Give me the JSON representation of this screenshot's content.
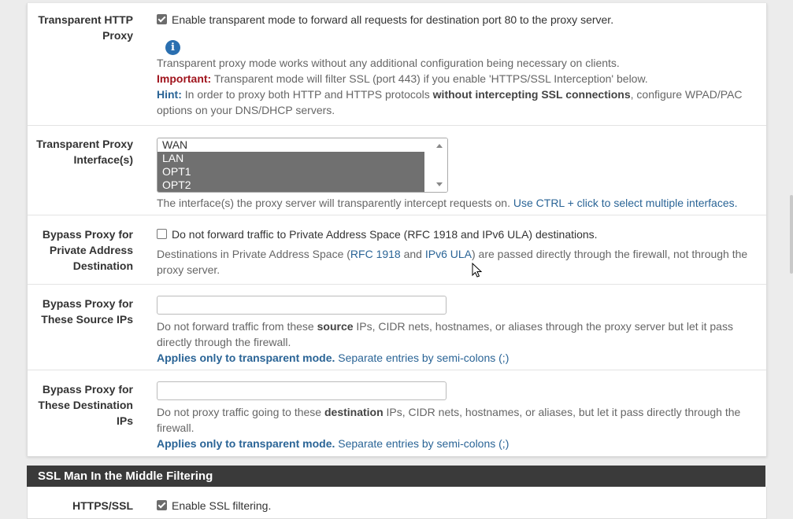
{
  "transparent_http": {
    "label": "Transparent HTTP Proxy",
    "checked": true,
    "checkbox_text": "Enable transparent mode to forward all requests for destination port 80 to the proxy server.",
    "info_icon": "info-icon",
    "help_line1": "Transparent proxy mode works without any additional configuration being necessary on clients.",
    "important_label": "Important:",
    "important_text": " Transparent mode will filter SSL (port 443) if you enable 'HTTPS/SSL Interception' below.",
    "hint_label": "Hint:",
    "hint_text1": " In order to proxy both HTTP and HTTPS protocols ",
    "hint_bold": "without intercepting SSL connections",
    "hint_text2": ", configure WPAD/PAC",
    "hint_text3": "options on your DNS/DHCP servers."
  },
  "transparent_interfaces": {
    "label": "Transparent Proxy Interface(s)",
    "options": [
      {
        "label": "WAN",
        "selected": false
      },
      {
        "label": "LAN",
        "selected": true
      },
      {
        "label": "OPT1",
        "selected": true
      },
      {
        "label": "OPT2",
        "selected": true
      }
    ],
    "help": "The interface(s) the proxy server will transparently intercept requests on. ",
    "help_link": "Use CTRL + click to select multiple interfaces."
  },
  "bypass_private": {
    "label": "Bypass Proxy for Private Address Destination",
    "checked": false,
    "checkbox_text": "Do not forward traffic to Private Address Space (RFC 1918 and IPv6 ULA) destinations.",
    "help_pre": "Destinations in Private Address Space (",
    "link_rfc": "RFC 1918",
    "help_and": " and ",
    "link_ipv6": "IPv6 ULA",
    "help_post": ") are passed directly through the firewall, not through the",
    "help_line2": "proxy server."
  },
  "bypass_source": {
    "label": "Bypass Proxy for These Source IPs",
    "value": "",
    "help_pre": "Do not forward traffic from these ",
    "help_bold": "source",
    "help_post": " IPs, CIDR nets, hostnames, or aliases through the proxy server but let it pass",
    "help_line2": "directly through the firewall.",
    "applies_bold": "Applies only to transparent mode.",
    "applies_text": " Separate entries by semi-colons (;)"
  },
  "bypass_dest": {
    "label": "Bypass Proxy for These Destination IPs",
    "value": "",
    "help_pre": "Do not proxy traffic going to these ",
    "help_bold": "destination",
    "help_post": " IPs, CIDR nets, hostnames, or aliases, but let it pass directly through the",
    "help_line2": "firewall.",
    "applies_bold": "Applies only to transparent mode.",
    "applies_text": " Separate entries by semi-colons (;)"
  },
  "ssl_section": {
    "title": "SSL Man In the Middle Filtering",
    "https_label": "HTTPS/SSL",
    "checked": true,
    "checkbox_text": "Enable SSL filtering."
  }
}
